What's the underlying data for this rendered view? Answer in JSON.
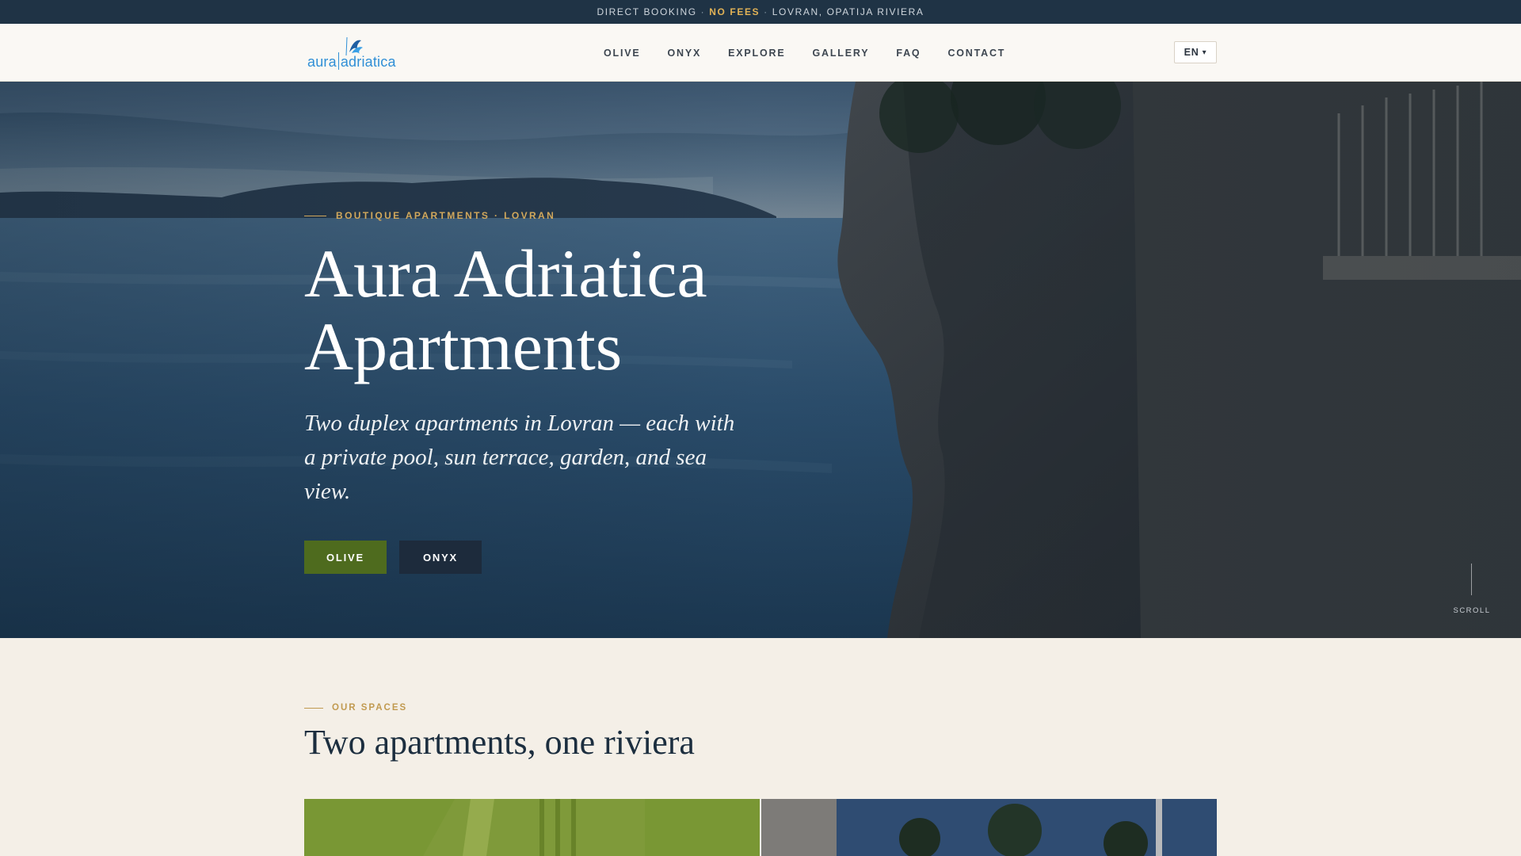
{
  "topbar": {
    "part1": "DIRECT BOOKING",
    "sep1": "·",
    "fees": "NO FEES",
    "sep2": "·",
    "location": "LOVRAN, OPATIJA RIVIERA"
  },
  "header": {
    "logo_word1": "aura",
    "logo_word2": "adriatica",
    "nav": [
      "OLIVE",
      "ONYX",
      "EXPLORE",
      "GALLERY",
      "FAQ",
      "CONTACT"
    ],
    "language": "EN",
    "language_caret": "▾"
  },
  "hero": {
    "eyebrow": "BOUTIQUE APARTMENTS · LOVRAN",
    "title_line1": "Aura Adriatica",
    "title_line2": "Apartments",
    "subtitle": "Two duplex apartments in Lovran — each with a private pool, sun terrace, garden, and sea view.",
    "buttons": {
      "olive": "OLIVE",
      "onyx": "ONYX"
    },
    "scroll_label": "SCROLL"
  },
  "spaces": {
    "eyebrow": "OUR SPACES",
    "title": "Two apartments, one riviera"
  },
  "colors": {
    "topbar_bg": "#1f3345",
    "fees_accent": "#e1b256",
    "gold_accent": "#d1a85c",
    "olive_button": "#4e6b1e",
    "onyx_button": "#1d2b3c",
    "heading_navy": "#1c2e3f",
    "logo_blue": "#2f8fd6"
  }
}
